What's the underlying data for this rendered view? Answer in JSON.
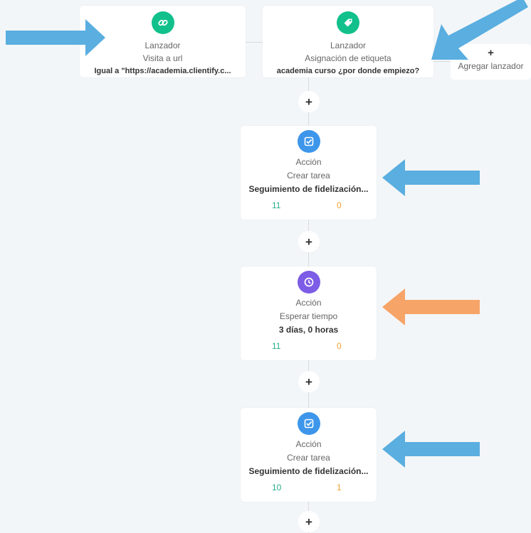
{
  "colors": {
    "trigger_icon": "#12c08c",
    "task_icon": "#3d96ea",
    "wait_icon": "#7d5ce6",
    "blue_arrow": "#5aaee0",
    "orange_arrow": "#f7a468",
    "success": "#27b08a",
    "error": "#f0a030"
  },
  "triggers": [
    {
      "icon": "link-icon",
      "type": "Lanzador",
      "subtype": "Visita a url",
      "detail": "Igual a \"https://academia.clientify.c..."
    },
    {
      "icon": "tag-icon",
      "type": "Lanzador",
      "subtype": "Asignación de etiqueta",
      "detail": "academia curso ¿por donde empiezo?"
    }
  ],
  "add_trigger": {
    "plus": "+",
    "label": "Agregar lanzador"
  },
  "add_step": {
    "plus": "+"
  },
  "actions": [
    {
      "icon": "task-check-icon",
      "type": "Acción",
      "subtype": "Crear tarea",
      "detail": "Seguimiento de fidelización...",
      "success_count": "11",
      "error_count": "0"
    },
    {
      "icon": "clock-icon",
      "type": "Acción",
      "subtype": "Esperar tiempo",
      "detail": "3 días, 0 horas",
      "success_count": "11",
      "error_count": "0"
    },
    {
      "icon": "task-check-icon",
      "type": "Acción",
      "subtype": "Crear tarea",
      "detail": "Seguimiento de fidelización...",
      "success_count": "10",
      "error_count": "1"
    }
  ]
}
